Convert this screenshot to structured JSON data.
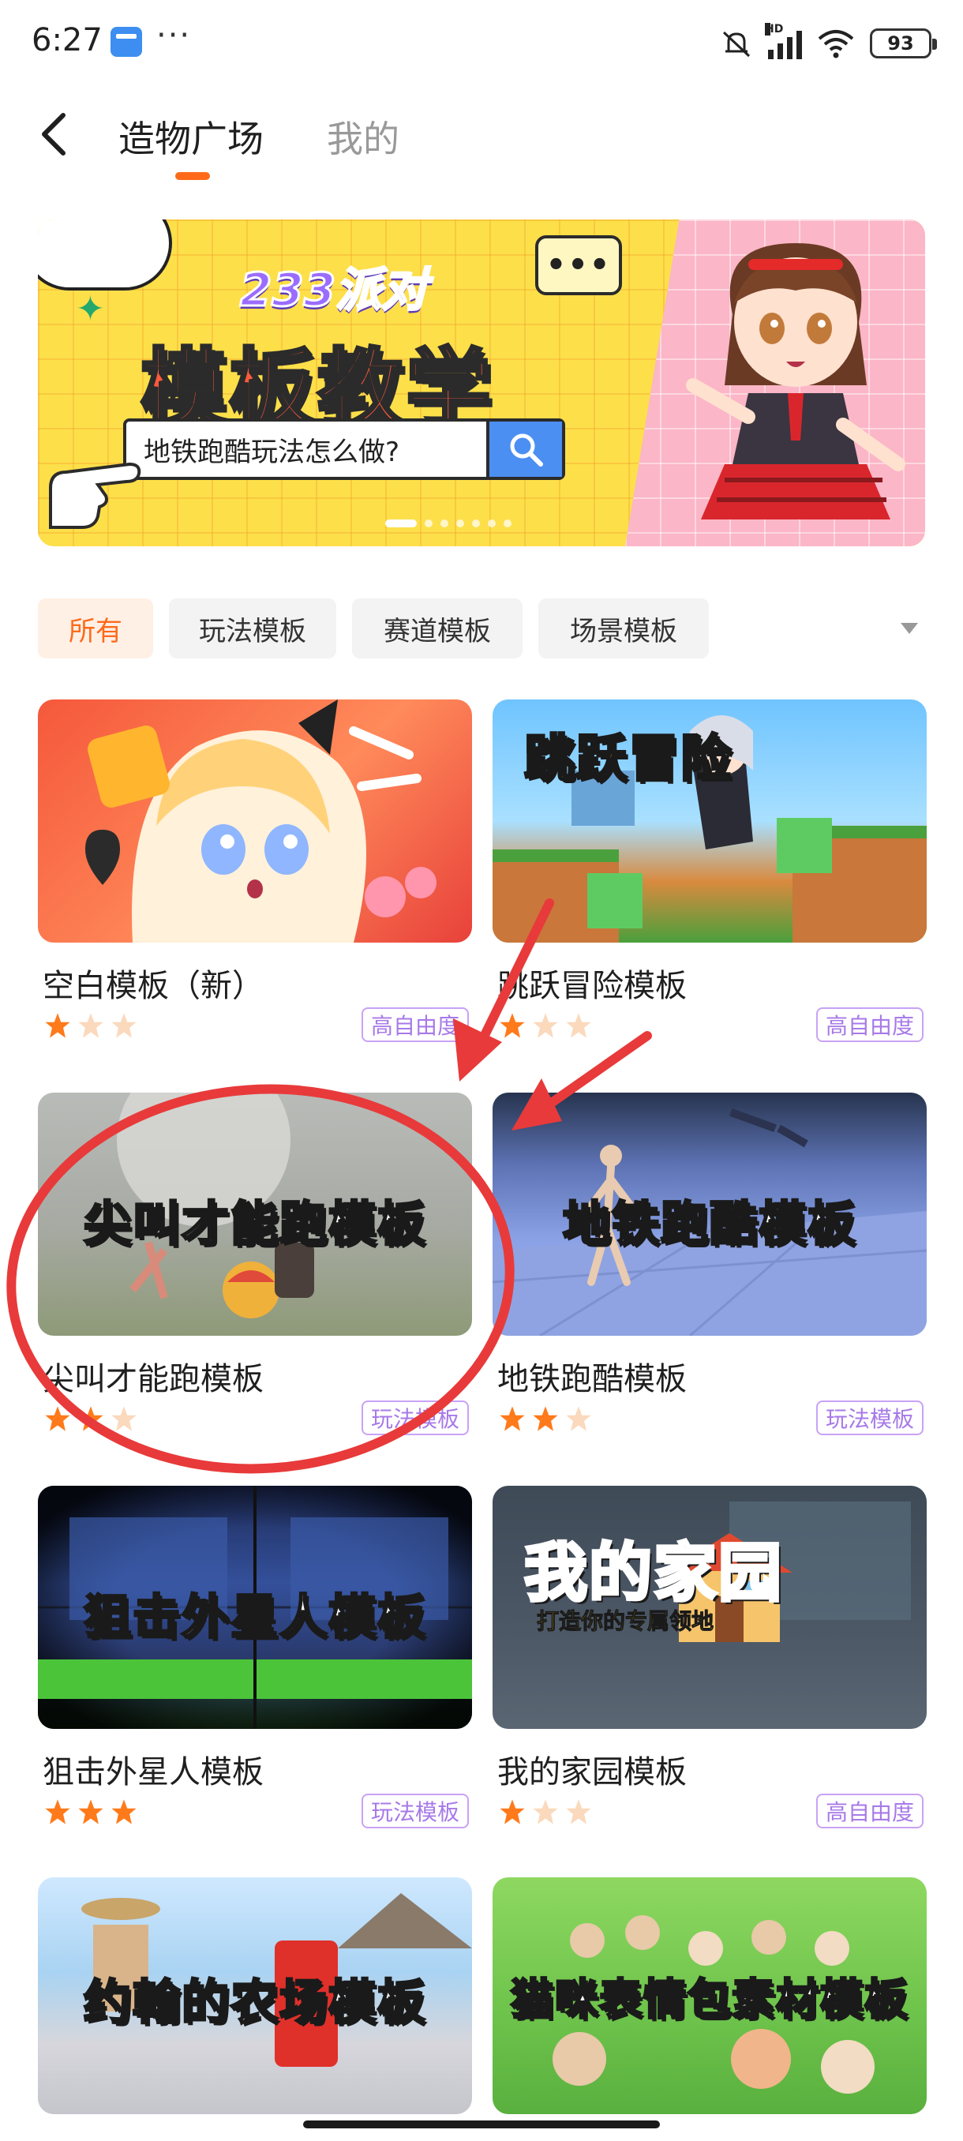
{
  "status_bar": {
    "time": "6:27",
    "more": "···",
    "network": "HD",
    "battery": "93"
  },
  "header": {
    "tabs": [
      {
        "label": "造物广场",
        "active": true
      },
      {
        "label": "我的",
        "active": false
      }
    ],
    "accent_color": "#ff6a1a"
  },
  "banner": {
    "brand": "233派对",
    "title": "模板教学",
    "search_text": "地铁跑酷玩法怎么做?",
    "page_count": 7,
    "current_page": 1
  },
  "filters": {
    "chips": [
      "所有",
      "玩法模板",
      "赛道模板",
      "场景模板"
    ],
    "selected": "所有"
  },
  "templates": [
    {
      "title": "空白模板（新）",
      "thumb_text": "",
      "stars": 1,
      "tag": "高自由度"
    },
    {
      "title": "跳跃冒险模板",
      "thumb_text": "跳跃冒险",
      "stars": 1,
      "tag": "高自由度"
    },
    {
      "title": "尖叫才能跑模板",
      "thumb_text": "尖叫才能跑模板",
      "stars": 2,
      "tag": "玩法模板"
    },
    {
      "title": "地铁跑酷模板",
      "thumb_text": "地铁跑酷模板",
      "stars": 2,
      "tag": "玩法模板"
    },
    {
      "title": "狙击外星人模板",
      "thumb_text": "狙击外星人模板",
      "stars": 3,
      "tag": "玩法模板"
    },
    {
      "title": "我的家园模板",
      "thumb_text": "我的家园",
      "thumb_subtext": "打造你的专属领地",
      "stars": 1,
      "tag": "高自由度"
    },
    {
      "title": "",
      "thumb_text": "约翰的农场模板",
      "stars": 0,
      "tag": ""
    },
    {
      "title": "",
      "thumb_text": "猫咪表情包素材模板",
      "stars": 0,
      "tag": ""
    }
  ],
  "colors": {
    "star_on": "#ff7a1a",
    "star_off": "#fbd9bd",
    "tag_border": "#c9a2f5",
    "annotation_red": "#e83a3a"
  }
}
